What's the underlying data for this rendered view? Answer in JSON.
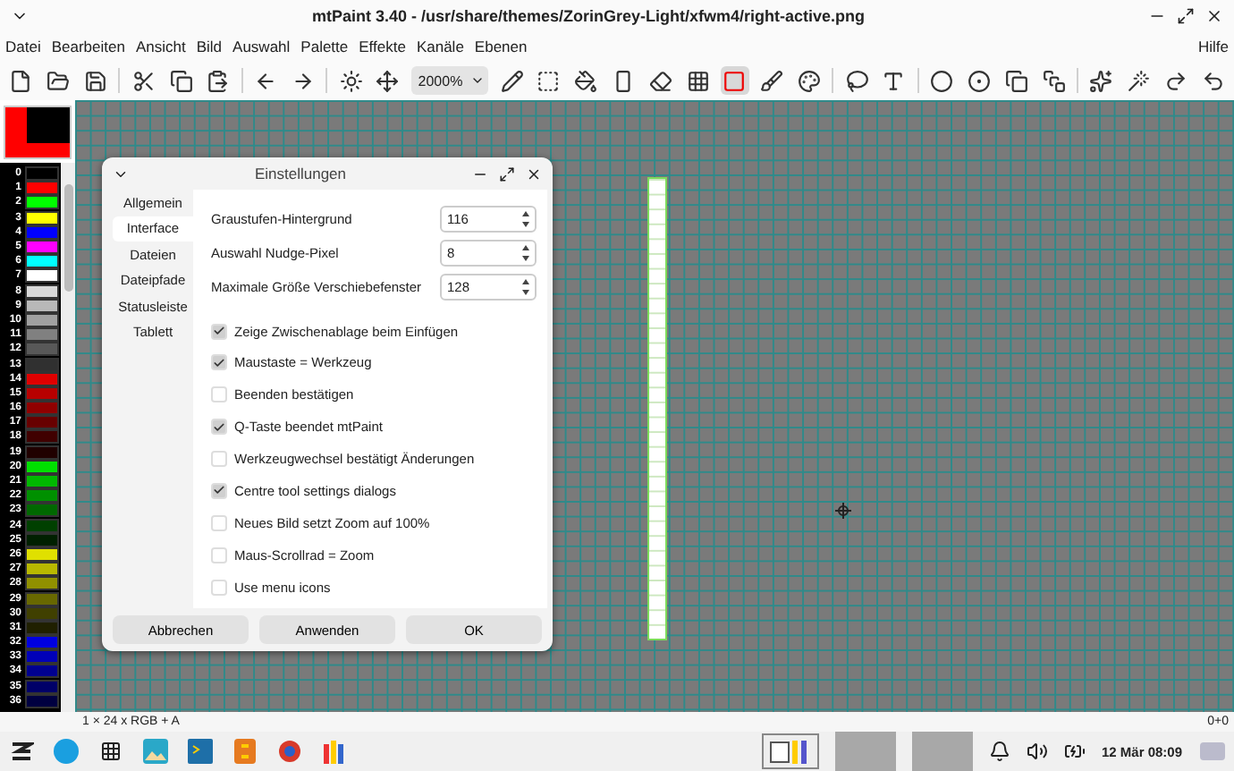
{
  "window": {
    "title": "mtPaint 3.40 - /usr/share/themes/ZorinGrey-Light/xfwm4/right-active.png"
  },
  "menu": [
    "Datei",
    "Bearbeiten",
    "Ansicht",
    "Bild",
    "Auswahl",
    "Palette",
    "Effekte",
    "Kanäle",
    "Ebenen"
  ],
  "help_menu": "Hilfe",
  "toolbar": {
    "zoom": "2000%",
    "tools": [
      {
        "selected": false
      },
      {
        "selected": false
      },
      {
        "selected": false
      },
      {
        "selected": false
      },
      {
        "selected": false
      },
      {
        "selected": false
      },
      {
        "selected": false
      },
      {
        "selected": false
      },
      {
        "selected": false
      },
      {
        "selected": false
      },
      {
        "selected": false
      },
      {
        "selected": false
      },
      {
        "selected": false
      },
      {
        "selected": false
      },
      {
        "selected": false
      },
      {
        "selected": false
      },
      {
        "selected": true
      },
      {
        "selected": false
      },
      {
        "selected": false
      },
      {
        "selected": false
      },
      {
        "selected": false
      },
      {
        "selected": false
      },
      {
        "selected": false
      },
      {
        "selected": false
      },
      {
        "selected": false
      },
      {
        "selected": false
      },
      {
        "selected": false
      },
      {
        "selected": false
      },
      {
        "selected": false
      }
    ]
  },
  "palette": [
    {
      "index": "0",
      "color": "#000000"
    },
    {
      "index": "1",
      "color": "#ff0000"
    },
    {
      "index": "2",
      "color": "#00ff00"
    },
    {
      "index": "3",
      "color": "#ffff00"
    },
    {
      "index": "4",
      "color": "#0000ff"
    },
    {
      "index": "5",
      "color": "#ff00ff"
    },
    {
      "index": "6",
      "color": "#00ffff"
    },
    {
      "index": "7",
      "color": "#ffffff"
    },
    {
      "index": "8",
      "color": "#d8d8d8"
    },
    {
      "index": "9",
      "color": "#b8b8b8"
    },
    {
      "index": "10",
      "color": "#a0a0a0"
    },
    {
      "index": "11",
      "color": "#808080"
    },
    {
      "index": "12",
      "color": "#585858"
    },
    {
      "index": "13",
      "color": "#303030"
    },
    {
      "index": "14",
      "color": "#e00000"
    },
    {
      "index": "15",
      "color": "#b80000"
    },
    {
      "index": "16",
      "color": "#900000"
    },
    {
      "index": "17",
      "color": "#680000"
    },
    {
      "index": "18",
      "color": "#400000"
    },
    {
      "index": "19",
      "color": "#200000"
    },
    {
      "index": "20",
      "color": "#00e000"
    },
    {
      "index": "21",
      "color": "#00b800"
    },
    {
      "index": "22",
      "color": "#009000"
    },
    {
      "index": "23",
      "color": "#006800"
    },
    {
      "index": "24",
      "color": "#004000"
    },
    {
      "index": "25",
      "color": "#002000"
    },
    {
      "index": "26",
      "color": "#e0e000"
    },
    {
      "index": "27",
      "color": "#b8b800"
    },
    {
      "index": "28",
      "color": "#909000"
    },
    {
      "index": "29",
      "color": "#686800"
    },
    {
      "index": "30",
      "color": "#404000"
    },
    {
      "index": "31",
      "color": "#202000"
    },
    {
      "index": "32",
      "color": "#0000e0"
    },
    {
      "index": "33",
      "color": "#0000b8"
    },
    {
      "index": "34",
      "color": "#000090"
    },
    {
      "index": "35",
      "color": "#000068"
    },
    {
      "index": "36",
      "color": "#000040"
    }
  ],
  "dialog": {
    "title": "Einstellungen",
    "tabs": [
      {
        "label": "Allgemein",
        "selected": false
      },
      {
        "label": "Interface",
        "selected": true
      },
      {
        "label": "Dateien",
        "selected": false
      },
      {
        "label": "Dateipfade",
        "selected": false
      },
      {
        "label": "Statusleiste",
        "selected": false
      },
      {
        "label": "Tablett",
        "selected": false
      }
    ],
    "spins": [
      {
        "label": "Graustufen-Hintergrund",
        "value": "116"
      },
      {
        "label": "Auswahl Nudge-Pixel",
        "value": "8"
      },
      {
        "label": "Maximale Größe Verschiebefenster",
        "value": "128"
      }
    ],
    "checks": [
      {
        "label": "Zeige Zwischenablage beim Einfügen",
        "checked": true
      },
      {
        "label": "Maustaste = Werkzeug",
        "checked": true
      },
      {
        "label": "Beenden bestätigen",
        "checked": false
      },
      {
        "label": "Q-Taste beendet mtPaint",
        "checked": true
      },
      {
        "label": "Werkzeugwechsel bestätigt Änderungen",
        "checked": false
      },
      {
        "label": "Centre tool settings dialogs",
        "checked": true
      },
      {
        "label": "Neues Bild setzt Zoom auf 100%",
        "checked": false
      },
      {
        "label": "Maus-Scrollrad = Zoom",
        "checked": false
      },
      {
        "label": "Use menu icons",
        "checked": false
      }
    ],
    "buttons": [
      "Abbrechen",
      "Anwenden",
      "OK"
    ]
  },
  "status_bar": {
    "left": "1 × 24 x RGB + A",
    "right": "0+0"
  },
  "taskbar": {
    "clock": "12 Mär 08:09"
  }
}
